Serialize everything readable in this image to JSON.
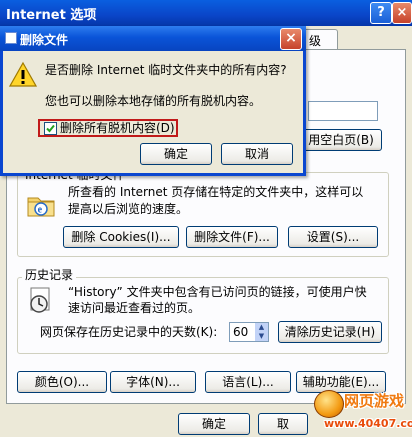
{
  "options_window": {
    "title": "Internet 选项",
    "help_button": "?",
    "close_button": "×",
    "tab_partial": "级",
    "home_button_partial": "用空白页(B)",
    "temp_files": {
      "group_label": "Internet 临时文件",
      "description_line1": "所查看的 Internet 页存储在特定的文件夹中，这样可以",
      "description_line2": "提高以后浏览的速度。",
      "delete_cookies": "删除 Cookies(I)...",
      "delete_files": "删除文件(F)...",
      "settings": "设置(S)..."
    },
    "history": {
      "group_label": "历史记录",
      "description_line1": "“History” 文件夹中包含有已访问页的链接，可使用户快",
      "description_line2": "速访问最近查看过的页。",
      "days_label": "网页保存在历史记录中的天数(K):",
      "days_value": "60",
      "clear_button": "清除历史记录(H)"
    },
    "bottom_buttons": {
      "colors": "颜色(O)...",
      "fonts": "字体(N)...",
      "languages": "语言(L)...",
      "accessibility": "辅助功能(E)..."
    },
    "ok_button": "确定",
    "cancel_button_partial": "取"
  },
  "delete_dialog": {
    "title": "删除文件",
    "close_button": "×",
    "question": "是否删除 Internet 临时文件夹中的所有内容?",
    "info": "您也可以删除本地存储的所有脱机内容。",
    "checkbox_label": "删除所有脱机内容(D)",
    "checkbox_checked": true,
    "ok_button": "确定",
    "cancel_button": "取消"
  },
  "watermark": {
    "brand": "网页游戏",
    "url": "www.40407.com"
  },
  "colors": {
    "titlebar_blue": "#0a54d8",
    "highlight_red": "#c11a1a",
    "window_bg": "#ece9d8",
    "watermark_orange": "#f07a10"
  }
}
